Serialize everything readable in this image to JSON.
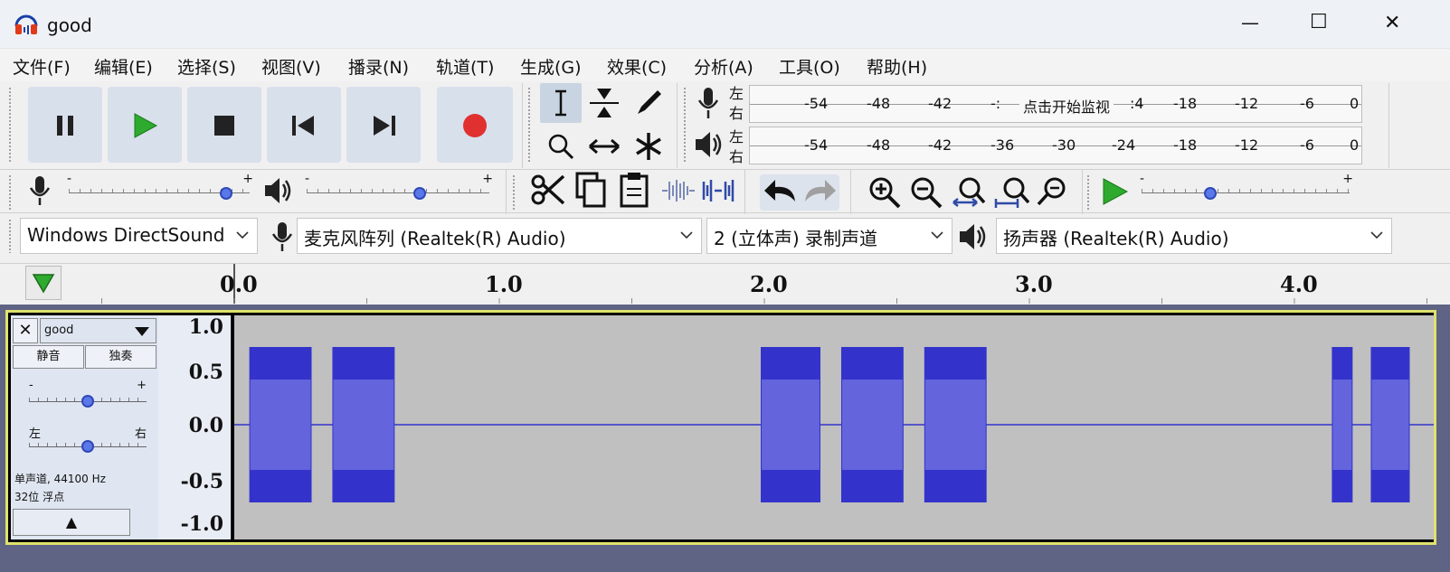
{
  "window": {
    "title": "good",
    "minimize_label": "—",
    "maximize_label": "☐",
    "close_label": "✕"
  },
  "menu": [
    "文件(F)",
    "编辑(E)",
    "选择(S)",
    "视图(V)",
    "播录(N)",
    "轨道(T)",
    "生成(G)",
    "效果(C)",
    "分析(A)",
    "工具(O)",
    "帮助(H)"
  ],
  "meters": {
    "record_ticks": [
      "-54",
      "-48",
      "-42",
      "-:",
      "点击开始监视",
      ":4",
      "-18",
      "-12",
      "-6",
      "0"
    ],
    "playback_ticks": [
      "-54",
      "-48",
      "-42",
      "-36",
      "-30",
      "-24",
      "-18",
      "-12",
      "-6",
      "0"
    ],
    "left": "左",
    "right": "右"
  },
  "sliders": {
    "minus": "-",
    "plus": "+",
    "record_volume": 0.88,
    "playback_volume": 0.62,
    "play_speed": 0.32
  },
  "devices": {
    "host": "Windows DirectSound",
    "input": "麦克风阵列 (Realtek(R) Audio)",
    "channels": "2 (立体声) 录制声道",
    "output": "扬声器 (Realtek(R) Audio)"
  },
  "ruler": {
    "labels": [
      "0.0",
      "1.0",
      "2.0",
      "3.0",
      "4.0"
    ]
  },
  "track": {
    "name": "good",
    "close_label": "✕",
    "mute_label": "静音",
    "solo_label": "独奏",
    "gain_minus": "-",
    "gain_plus": "+",
    "pan_left": "左",
    "pan_right": "右",
    "gain_value": 0.5,
    "pan_value": 0.5,
    "info_line1": "单声道, 44100 Hz",
    "info_line2": "32位 浮点",
    "collapse_label": "▲",
    "scale": [
      "1.0",
      "0.5",
      "0.0",
      "-0.5",
      "-1.0"
    ],
    "bursts_seconds": [
      [
        0.03,
        0.27
      ],
      [
        0.35,
        0.59
      ],
      [
        2.0,
        2.23
      ],
      [
        2.31,
        2.55
      ],
      [
        2.63,
        2.87
      ],
      [
        4.2,
        4.28
      ],
      [
        4.35,
        4.5
      ]
    ]
  },
  "colors": {
    "waveform": "#3333cc",
    "waveform_rms": "#6464dc",
    "wave_bg": "#c0c0c0",
    "track_selected_border": "#dfe26c",
    "record": "#e03030",
    "play": "#2eaa2e",
    "background": "#5f6485"
  }
}
